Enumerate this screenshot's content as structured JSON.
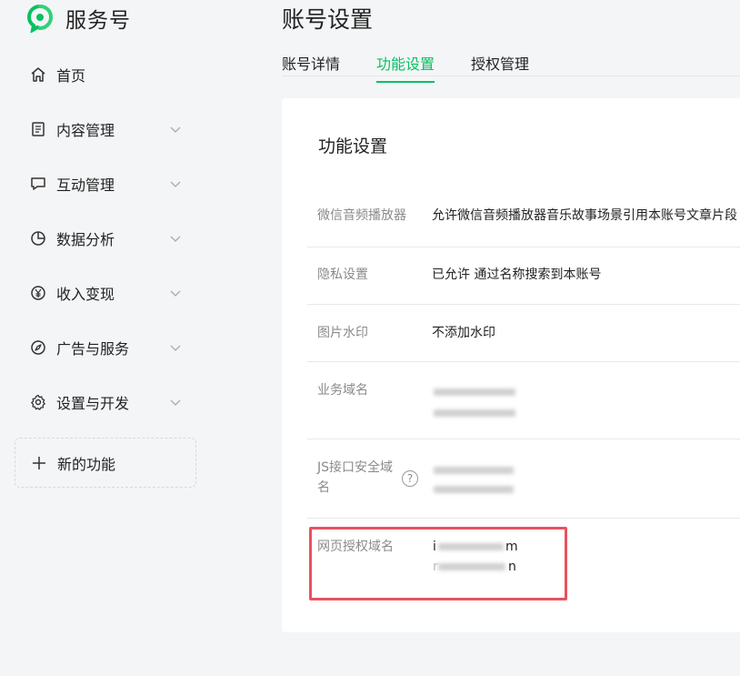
{
  "brand": {
    "name": "服务号",
    "logo_icon": "wechat-service-logo-icon",
    "accent": "#07c160"
  },
  "sidebar": {
    "items": [
      {
        "label": "首页",
        "icon": "home-icon",
        "has_children": false
      },
      {
        "label": "内容管理",
        "icon": "document-icon",
        "has_children": true
      },
      {
        "label": "互动管理",
        "icon": "chat-icon",
        "has_children": true
      },
      {
        "label": "数据分析",
        "icon": "pie-chart-icon",
        "has_children": true
      },
      {
        "label": "收入变现",
        "icon": "yen-icon",
        "has_children": true
      },
      {
        "label": "广告与服务",
        "icon": "compass-icon",
        "has_children": true
      },
      {
        "label": "设置与开发",
        "icon": "gear-icon",
        "has_children": true
      }
    ],
    "new_feature": {
      "label": "新的功能",
      "icon": "plus-icon"
    }
  },
  "header": {
    "title": "账号设置"
  },
  "tabs": [
    {
      "label": "账号详情",
      "active": false
    },
    {
      "label": "功能设置",
      "active": true
    },
    {
      "label": "授权管理",
      "active": false
    }
  ],
  "section": {
    "title": "功能设置",
    "rows": [
      {
        "label": "微信音频播放器",
        "value": "允许微信音频播放器音乐故事场景引用本账号文章片段"
      },
      {
        "label": "隐私设置",
        "value": "已允许 通过名称搜索到本账号"
      },
      {
        "label": "图片水印",
        "value": "不添加水印"
      },
      {
        "label": "业务域名",
        "value": ""
      },
      {
        "label": "JS接口安全域名",
        "value": "",
        "help_icon": "question-circle-icon"
      },
      {
        "label": "网页授权域名",
        "value_lines": [
          "i",
          "m",
          "r",
          "n"
        ]
      }
    ]
  },
  "colors": {
    "highlight_border": "#e8525f",
    "active_tab": "#07c160"
  }
}
